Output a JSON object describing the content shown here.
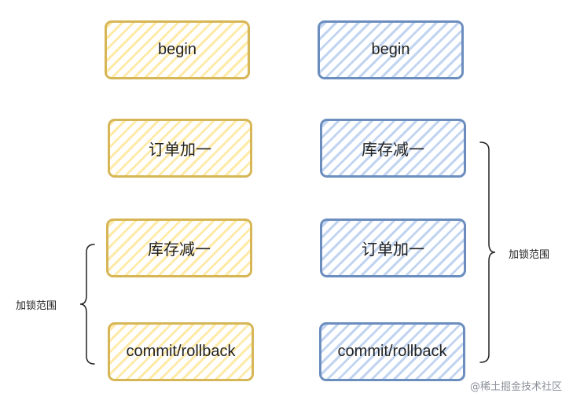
{
  "colors": {
    "yellow_border": "#d6b656",
    "yellow_fill": "#fff2cc",
    "blue_border": "#6c8ebf",
    "blue_fill": "#dae8fc",
    "watermark": "#8a8f99"
  },
  "left_flow": {
    "steps": [
      {
        "label": "begin"
      },
      {
        "label": "订单加一"
      },
      {
        "label": "库存减一"
      },
      {
        "label": "commit/rollback"
      }
    ],
    "lock_label": "加锁范围"
  },
  "right_flow": {
    "steps": [
      {
        "label": "begin"
      },
      {
        "label": "库存减一"
      },
      {
        "label": "订单加一"
      },
      {
        "label": "commit/rollback"
      }
    ],
    "lock_label": "加锁范围"
  },
  "watermark": "@稀土掘金技术社区"
}
